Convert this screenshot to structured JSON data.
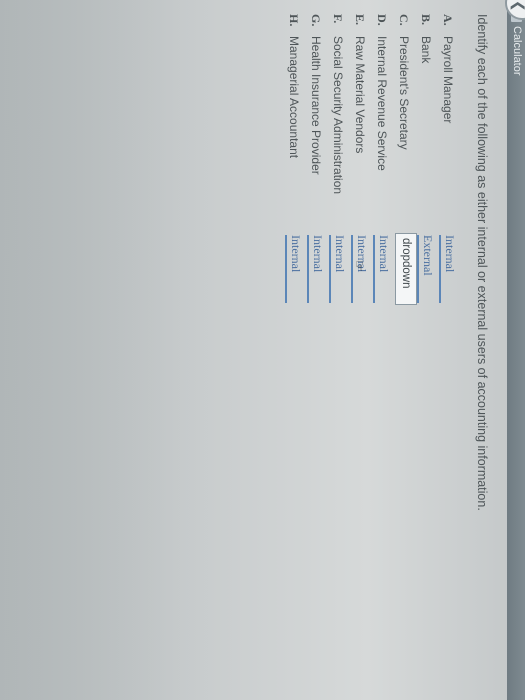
{
  "header": {
    "app_label": "Calculator"
  },
  "question": {
    "instruction": "Identify each of the following as either internal or external users of accounting information."
  },
  "items": [
    {
      "letter": "A.",
      "label": "Payroll Manager",
      "answer": "Internal"
    },
    {
      "letter": "B.",
      "label": "Bank",
      "answer": "External"
    },
    {
      "letter": "C.",
      "label": "President's Secretary",
      "answer": "dropdown"
    },
    {
      "letter": "D.",
      "label": "Internal Revenue Service",
      "answer": "Internal"
    },
    {
      "letter": "E.",
      "label": "Raw Material Vendors",
      "answer": "Internal"
    },
    {
      "letter": "F.",
      "label": "Social Security Administration",
      "answer": "Internal"
    },
    {
      "letter": "G.",
      "label": "Health Insurance Provider",
      "answer": "Internal"
    },
    {
      "letter": "H.",
      "label": "Managerial Accountant",
      "answer": "Internal"
    }
  ],
  "icons": {
    "back": "chevron-left-icon",
    "calculator": "calculator-icon",
    "cursor": "hand-cursor-icon"
  }
}
